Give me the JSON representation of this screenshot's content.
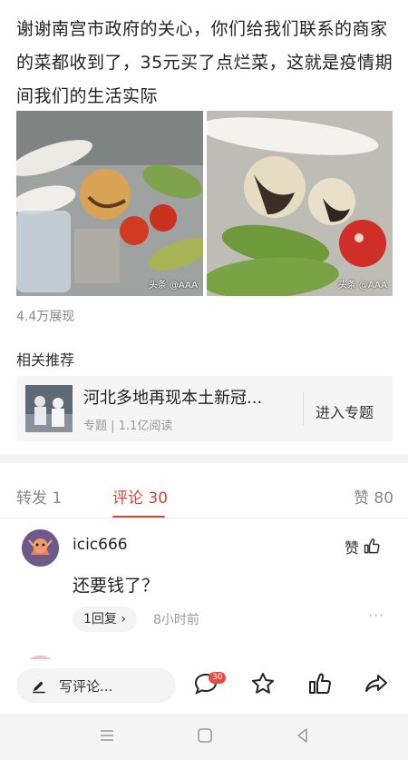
{
  "post": {
    "text": "谢谢南宫市政府的关心，你们给我们联系的商家的菜都收到了，35元买了点烂菜，这就是疫情期间我们的生活实际",
    "photo_watermark_left": "头条 @AAA",
    "photo_watermark_right": "头条 @AAA",
    "views": "4.4万展现"
  },
  "related": {
    "title": "相关推荐",
    "card_title": "河北多地再现本土新冠...",
    "card_meta": "专题 | 1.1亿阅读",
    "card_link": "进入专题"
  },
  "tabs": {
    "repost": "转发 1",
    "comments": "评论 30",
    "likes": "赞 80"
  },
  "comment": {
    "user": "icic666",
    "like_label": "赞",
    "body": "还要钱了？",
    "reply_label": "1回复 ›",
    "time": "8小时前",
    "more": "···"
  },
  "bottom_bar": {
    "write_placeholder": "写评论...",
    "comment_badge": "30",
    "icons": [
      "pen-icon",
      "comment-icon",
      "star-icon",
      "thumbs-up-icon",
      "share-icon"
    ]
  },
  "system_nav": [
    "menu-icon",
    "home-icon",
    "back-icon"
  ],
  "colors": {
    "accent": "#d4453b",
    "badge": "#e94843"
  }
}
